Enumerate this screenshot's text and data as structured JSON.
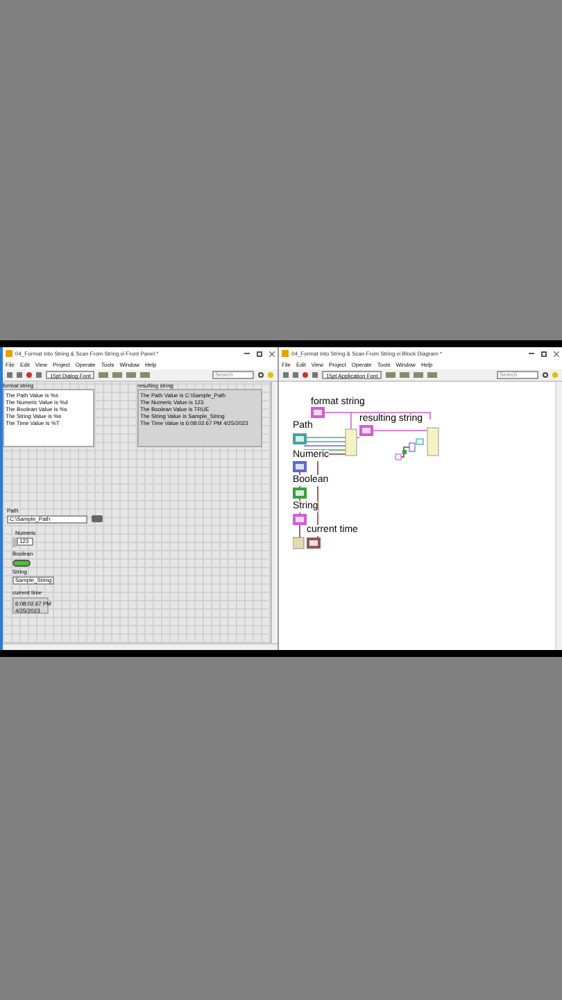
{
  "front_panel": {
    "title": "04_Format Into String & Scan From String.vi Front Panel *",
    "menu": [
      "File",
      "Edit",
      "View",
      "Project",
      "Operate",
      "Tools",
      "Window",
      "Help"
    ],
    "font_selector": "15pt Dialog Font",
    "search": {
      "placeholder": "Search"
    },
    "format_string": {
      "label": "format string",
      "lines": [
        "The Path Value is %s",
        "The Numeric Value is %d",
        "The Boolean Value is %s",
        "The String Value is %s",
        "The Time Value is %T"
      ]
    },
    "resulting_string": {
      "label": "resulting string",
      "lines": [
        "The Path Value is C:\\Sample_Path",
        "The Numeric Value is 123",
        "The Boolean Value is TRUE",
        "The String Value is Sample_String",
        "The Time Value is 6:08:02.67 PM 4/25/2023"
      ]
    },
    "path": {
      "label": "Path",
      "value": "C:\\Sample_Path"
    },
    "numeric": {
      "label": "Numeric",
      "value": "123"
    },
    "boolean": {
      "label": "Boolean",
      "on": true
    },
    "string": {
      "label": "String",
      "value": "Sample_String"
    },
    "current_time": {
      "label": "current time",
      "lines": [
        "6:08:02.67 PM",
        "4/25/2023"
      ]
    }
  },
  "block_diagram": {
    "title": "04_Format Into String & Scan From String.vi Block Diagram *",
    "menu": [
      "File",
      "Edit",
      "View",
      "Project",
      "Operate",
      "Tools",
      "Window",
      "Help"
    ],
    "font_selector": "15pt Application Font",
    "search": {
      "placeholder": "Search"
    },
    "terminals": [
      {
        "label": "format string",
        "kind": "string"
      },
      {
        "label": "Path",
        "kind": "path"
      },
      {
        "label": "resulting string",
        "kind": "string"
      },
      {
        "label": "Numeric",
        "kind": "numeric"
      },
      {
        "label": "Boolean",
        "kind": "boolean"
      },
      {
        "label": "String",
        "kind": "string"
      },
      {
        "label": "current time",
        "kind": "timestamp"
      }
    ]
  }
}
